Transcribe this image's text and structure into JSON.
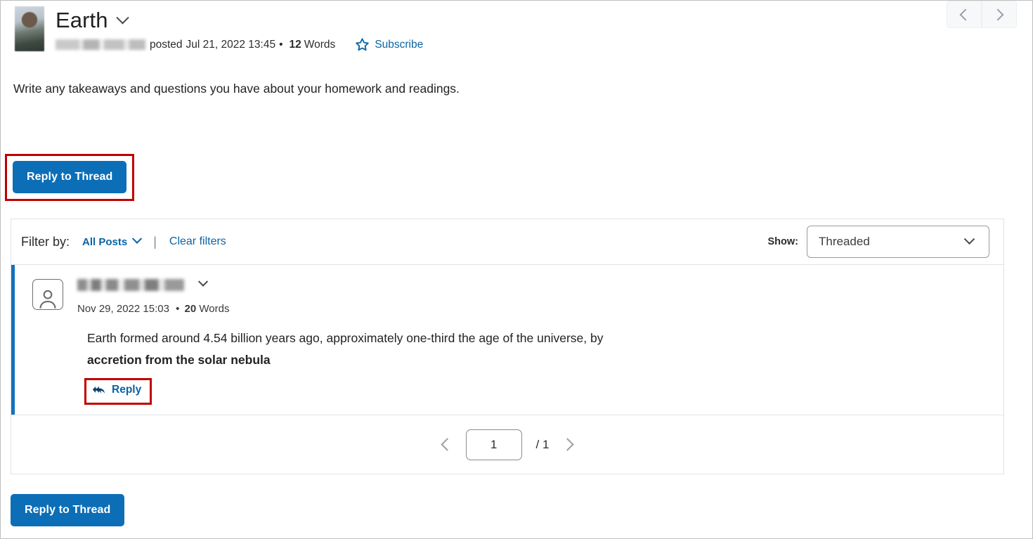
{
  "header": {
    "title": "Earth",
    "title_dropdown_icon": "chevron-down-icon",
    "avatar_icon": "user-photo-avatar",
    "author_name": "",
    "posted_prefix": "posted",
    "posted_date": "Jul 21, 2022 13:45",
    "separator": "•",
    "word_count": "12",
    "words_label": "Words",
    "subscribe_label": "Subscribe",
    "subscribe_icon": "star-outline-icon",
    "prev_icon": "chevron-left-icon",
    "next_icon": "chevron-right-icon"
  },
  "thread": {
    "description": "Write any takeaways and questions you have about your homework and readings."
  },
  "actions": {
    "reply_to_thread_top": "Reply to Thread",
    "reply_to_thread_bottom": "Reply to Thread"
  },
  "filter_bar": {
    "filter_by_label": "Filter by:",
    "all_posts_label": "All Posts",
    "all_posts_icon": "chevron-down-icon",
    "separator": "|",
    "clear_filters_label": "Clear filters",
    "show_label": "Show:",
    "show_value": "Threaded",
    "show_icon": "chevron-down-icon"
  },
  "post": {
    "avatar_icon": "person-silhouette-icon",
    "author_name": "",
    "author_dropdown_icon": "chevron-down-icon",
    "date": "Nov 29, 2022 15:03",
    "separator": "•",
    "word_count": "20",
    "words_label": "Words",
    "body_plain": "Earth formed around 4.54 billion years ago, approximately one-third the age of the universe, by ",
    "body_bold": "accretion from the solar nebula",
    "reply_label": "Reply",
    "reply_icon": "reply-arrow-icon"
  },
  "pagination": {
    "prev_icon": "chevron-left-icon",
    "current_page": "1",
    "total_pages": "/ 1",
    "next_icon": "chevron-right-icon"
  },
  "colors": {
    "primary_blue": "#0c6eb7",
    "link_blue": "#0a64a4",
    "annotation_red": "#c00000",
    "post_accent": "#1271bd",
    "panel_border": "#dee3e8"
  }
}
